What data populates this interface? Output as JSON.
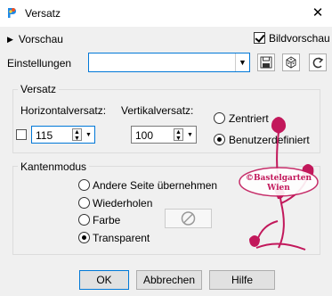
{
  "window": {
    "title": "Versatz",
    "close_glyph": "✕"
  },
  "preview": {
    "toggle_label": "Vorschau",
    "image_preview_label": "Bildvorschau",
    "image_preview_checked": true
  },
  "settings": {
    "label": "Einstellungen",
    "value": ""
  },
  "offset_group": {
    "title": "Versatz",
    "horizontal_label": "Horizontalversatz:",
    "horizontal_value": "115",
    "vertical_label": "Vertikalversatz:",
    "vertical_value": "100",
    "link_checked": false,
    "centered_label": "Zentriert",
    "custom_label": "Benutzerdefiniert",
    "selected": "custom"
  },
  "edge_group": {
    "title": "Kantenmodus",
    "options": [
      "Andere Seite übernehmen",
      "Wiederholen",
      "Farbe",
      "Transparent"
    ],
    "selected": "Transparent"
  },
  "buttons": {
    "ok": "OK",
    "cancel": "Abbrechen",
    "help": "Hilfe"
  },
  "watermark": {
    "text_line1": "©Bastelgarten",
    "text_line2": "Wien",
    "color": "#c2185b"
  },
  "colors": {
    "accent": "#0078d7",
    "background": "#f0f0f0"
  }
}
